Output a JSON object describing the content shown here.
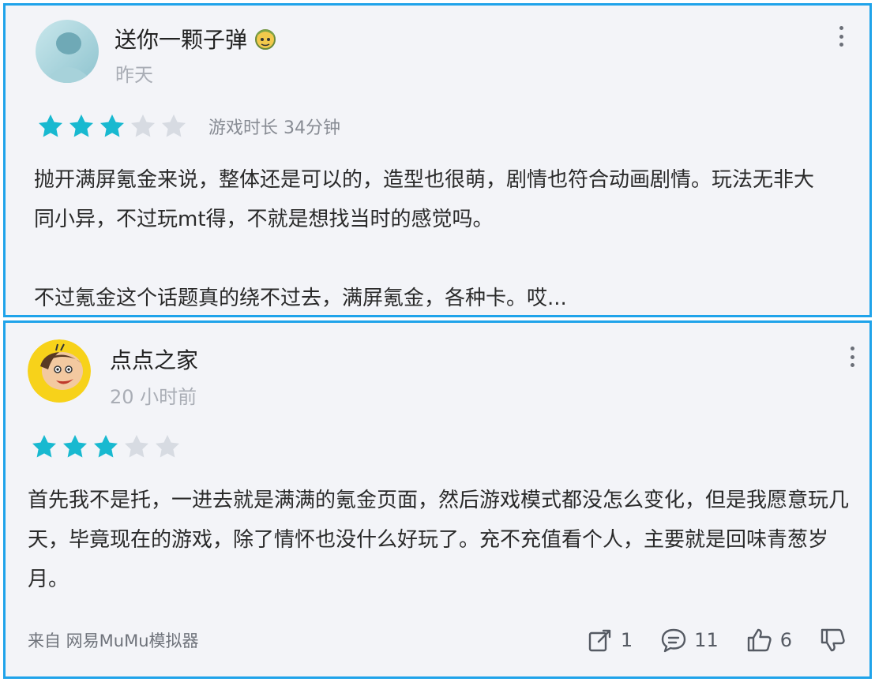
{
  "reviews": [
    {
      "username": "送你一颗子弹",
      "time": "昨天",
      "rating": 3,
      "rating_max": 5,
      "playtime": "游戏时长 34分钟",
      "paragraphs": [
        "抛开满屏氪金来说，整体还是可以的，造型也很萌，剧情也符合动画剧情。玩法无非大同小异，不过玩mt得，不就是想找当时的感觉吗。",
        "不过氪金这个话题真的绕不过去，满屏氪金，各种卡。哎..."
      ]
    },
    {
      "username": "点点之家",
      "time": "20 小时前",
      "rating": 3,
      "rating_max": 5,
      "paragraphs": [
        "首先我不是托，一进去就是满满的氪金页面，然后游戏模式都没怎么变化，但是我愿意玩几天，毕竟现在的游戏，除了情怀也没什么好玩了。充不充值看个人，主要就是回味青葱岁月。"
      ],
      "source": "来自 网易MuMu模拟器",
      "actions": {
        "share": "1",
        "comments": "11",
        "likes": "6"
      }
    }
  ],
  "colors": {
    "star_filled": "#18b9d0",
    "star_empty": "#d7dbe2",
    "border": "#1fa3ea"
  }
}
